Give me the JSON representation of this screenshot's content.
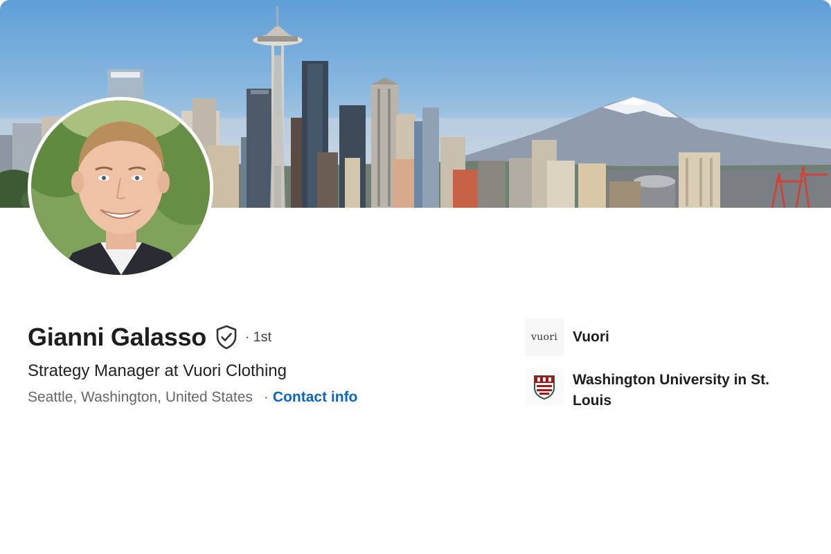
{
  "profile": {
    "name": "Gianni Galasso",
    "degree_dot": "·",
    "degree": "1st",
    "headline": "Strategy Manager at Vuori Clothing",
    "location": "Seattle, Washington, United States",
    "separator": "·",
    "contact_info_label": "Contact info"
  },
  "organizations": [
    {
      "name": "Vuori",
      "logo_text": "vuori",
      "logo_icon": "vuori-wordmark"
    },
    {
      "name": "Washington University in St. Louis",
      "logo_icon": "washu-shield"
    }
  ],
  "colors": {
    "link": "#0a66c2",
    "name_text": "#1d1d1d",
    "secondary_text": "#666666"
  },
  "icons": {
    "verified": "shield-check-icon"
  }
}
